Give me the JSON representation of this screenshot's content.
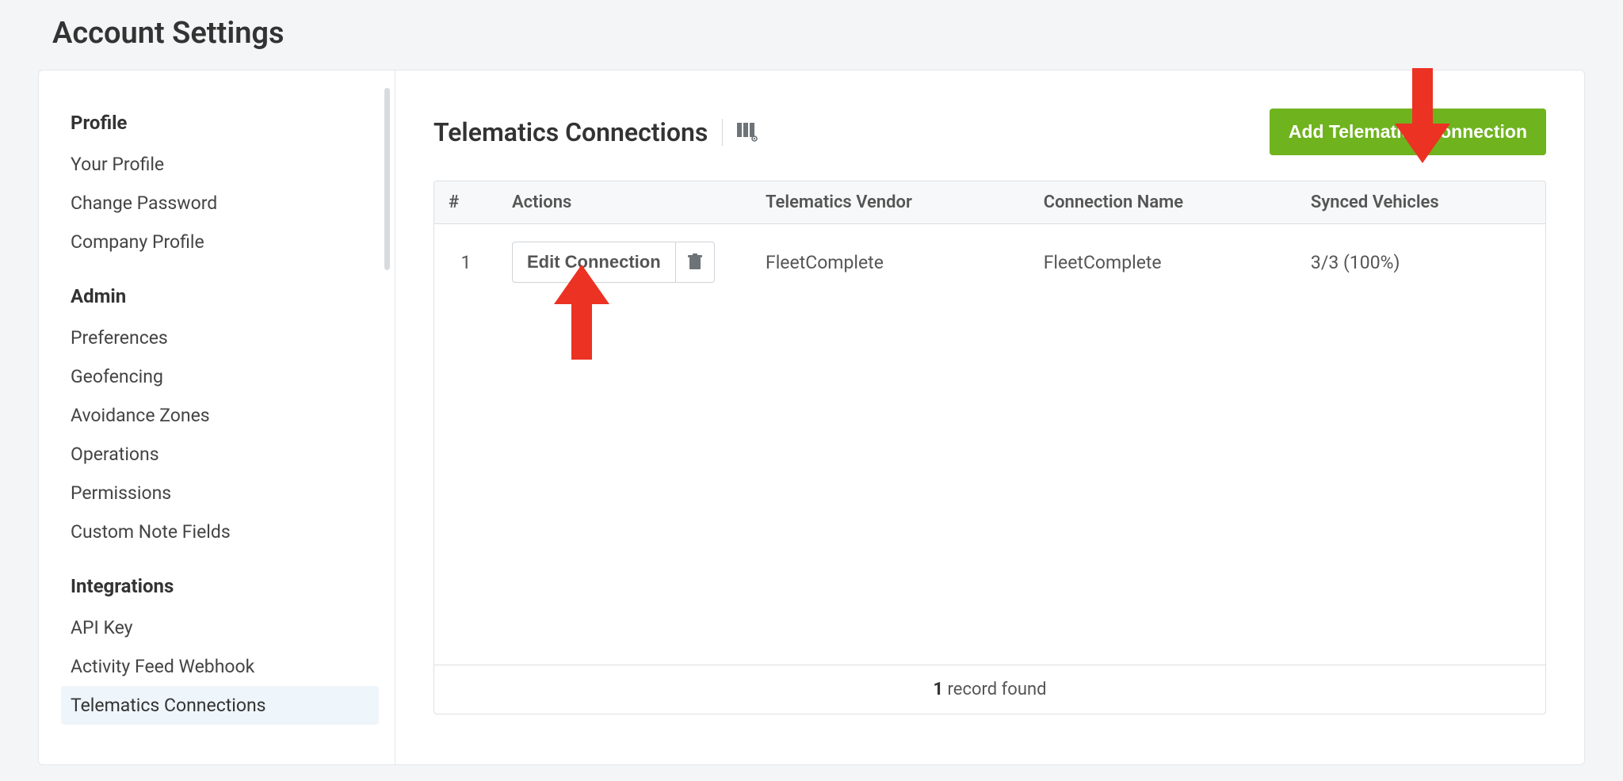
{
  "page": {
    "title": "Account Settings"
  },
  "sidebar": {
    "sections": [
      {
        "title": "Profile",
        "items": [
          "Your Profile",
          "Change Password",
          "Company Profile"
        ]
      },
      {
        "title": "Admin",
        "items": [
          "Preferences",
          "Geofencing",
          "Avoidance Zones",
          "Operations",
          "Permissions",
          "Custom Note Fields"
        ]
      },
      {
        "title": "Integrations",
        "items": [
          "API Key",
          "Activity Feed Webhook",
          "Telematics Connections"
        ]
      }
    ],
    "active": "Telematics Connections"
  },
  "main": {
    "title": "Telematics Connections",
    "add_button": "Add Telematics Connection",
    "columns": {
      "num": "#",
      "actions": "Actions",
      "vendor": "Telematics Vendor",
      "name": "Connection Name",
      "synced": "Synced Vehicles"
    },
    "rows": [
      {
        "num": "1",
        "edit": "Edit Connection",
        "vendor": "FleetComplete",
        "name": "FleetComplete",
        "synced": "3/3 (100%)"
      }
    ],
    "footer": {
      "count": "1",
      "text": " record found"
    }
  }
}
